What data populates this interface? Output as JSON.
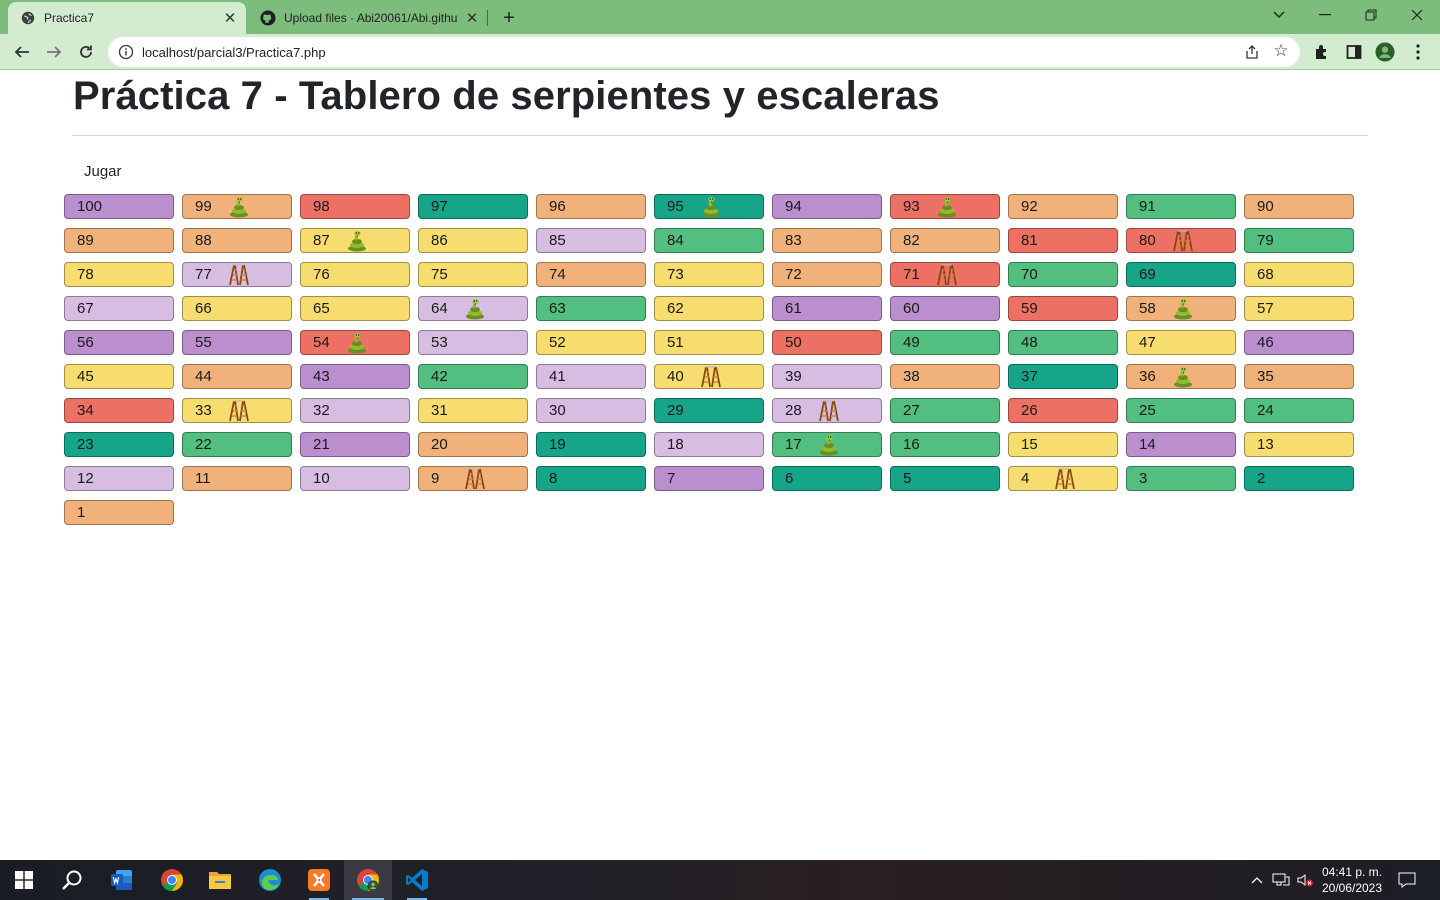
{
  "browser": {
    "tabs": [
      {
        "title": "Practica7",
        "active": true
      },
      {
        "title": "Upload files · Abi20061/Abi.githu",
        "active": false
      }
    ],
    "url": "localhost/parcial3/Practica7.php"
  },
  "page": {
    "title": "Práctica 7 - Tablero de serpientes y escaleras",
    "play_label": "Jugar"
  },
  "palette": {
    "purple": "#bb8fce",
    "orange": "#f0b27a",
    "red": "#ec7063",
    "teal": "#17a589",
    "green": "#52be80",
    "yellow": "#f7dc6f",
    "lavender": "#d7bde2"
  },
  "board": {
    "columns": 11,
    "cells": [
      {
        "n": "100",
        "c": "purple"
      },
      {
        "n": "99",
        "c": "orange",
        "icon": "snake"
      },
      {
        "n": "98",
        "c": "red"
      },
      {
        "n": "97",
        "c": "teal"
      },
      {
        "n": "96",
        "c": "orange"
      },
      {
        "n": "95",
        "c": "teal",
        "icon": "snake"
      },
      {
        "n": "94",
        "c": "purple"
      },
      {
        "n": "93",
        "c": "red",
        "icon": "snake"
      },
      {
        "n": "92",
        "c": "orange"
      },
      {
        "n": "91",
        "c": "green"
      },
      {
        "n": "90",
        "c": "orange"
      },
      {
        "n": "89",
        "c": "orange"
      },
      {
        "n": "88",
        "c": "orange"
      },
      {
        "n": "87",
        "c": "yellow",
        "icon": "snake"
      },
      {
        "n": "86",
        "c": "yellow"
      },
      {
        "n": "85",
        "c": "lavender"
      },
      {
        "n": "84",
        "c": "green"
      },
      {
        "n": "83",
        "c": "orange"
      },
      {
        "n": "82",
        "c": "orange"
      },
      {
        "n": "81",
        "c": "red"
      },
      {
        "n": "80",
        "c": "red",
        "icon": "ladder"
      },
      {
        "n": "79",
        "c": "green"
      },
      {
        "n": "78",
        "c": "yellow"
      },
      {
        "n": "77",
        "c": "lavender",
        "icon": "ladder"
      },
      {
        "n": "76",
        "c": "yellow"
      },
      {
        "n": "75",
        "c": "yellow"
      },
      {
        "n": "74",
        "c": "orange"
      },
      {
        "n": "73",
        "c": "yellow"
      },
      {
        "n": "72",
        "c": "orange"
      },
      {
        "n": "71",
        "c": "red",
        "icon": "ladder"
      },
      {
        "n": "70",
        "c": "green"
      },
      {
        "n": "69",
        "c": "teal"
      },
      {
        "n": "68",
        "c": "yellow"
      },
      {
        "n": "67",
        "c": "lavender"
      },
      {
        "n": "66",
        "c": "yellow"
      },
      {
        "n": "65",
        "c": "yellow"
      },
      {
        "n": "64",
        "c": "lavender",
        "icon": "snake"
      },
      {
        "n": "63",
        "c": "green"
      },
      {
        "n": "62",
        "c": "yellow"
      },
      {
        "n": "61",
        "c": "purple"
      },
      {
        "n": "60",
        "c": "purple"
      },
      {
        "n": "59",
        "c": "red"
      },
      {
        "n": "58",
        "c": "orange",
        "icon": "snake"
      },
      {
        "n": "57",
        "c": "yellow"
      },
      {
        "n": "56",
        "c": "purple"
      },
      {
        "n": "55",
        "c": "purple"
      },
      {
        "n": "54",
        "c": "red",
        "icon": "snake"
      },
      {
        "n": "53",
        "c": "lavender"
      },
      {
        "n": "52",
        "c": "yellow"
      },
      {
        "n": "51",
        "c": "yellow"
      },
      {
        "n": "50",
        "c": "red"
      },
      {
        "n": "49",
        "c": "green"
      },
      {
        "n": "48",
        "c": "green"
      },
      {
        "n": "47",
        "c": "yellow"
      },
      {
        "n": "46",
        "c": "purple"
      },
      {
        "n": "45",
        "c": "yellow"
      },
      {
        "n": "44",
        "c": "orange"
      },
      {
        "n": "43",
        "c": "purple"
      },
      {
        "n": "42",
        "c": "green"
      },
      {
        "n": "41",
        "c": "lavender"
      },
      {
        "n": "40",
        "c": "yellow",
        "icon": "ladder"
      },
      {
        "n": "39",
        "c": "lavender"
      },
      {
        "n": "38",
        "c": "orange"
      },
      {
        "n": "37",
        "c": "teal"
      },
      {
        "n": "36",
        "c": "orange",
        "icon": "snake"
      },
      {
        "n": "35",
        "c": "orange"
      },
      {
        "n": "34",
        "c": "red"
      },
      {
        "n": "33",
        "c": "yellow",
        "icon": "ladder"
      },
      {
        "n": "32",
        "c": "lavender"
      },
      {
        "n": "31",
        "c": "yellow"
      },
      {
        "n": "30",
        "c": "lavender"
      },
      {
        "n": "29",
        "c": "teal"
      },
      {
        "n": "28",
        "c": "lavender",
        "icon": "ladder"
      },
      {
        "n": "27",
        "c": "green"
      },
      {
        "n": "26",
        "c": "red"
      },
      {
        "n": "25",
        "c": "green"
      },
      {
        "n": "24",
        "c": "green"
      },
      {
        "n": "23",
        "c": "teal"
      },
      {
        "n": "22",
        "c": "green"
      },
      {
        "n": "21",
        "c": "purple"
      },
      {
        "n": "20",
        "c": "orange"
      },
      {
        "n": "19",
        "c": "teal"
      },
      {
        "n": "18",
        "c": "lavender"
      },
      {
        "n": "17",
        "c": "green",
        "icon": "snake"
      },
      {
        "n": "16",
        "c": "green"
      },
      {
        "n": "15",
        "c": "yellow"
      },
      {
        "n": "14",
        "c": "purple"
      },
      {
        "n": "13",
        "c": "yellow"
      },
      {
        "n": "12",
        "c": "lavender"
      },
      {
        "n": "11",
        "c": "orange"
      },
      {
        "n": "10",
        "c": "lavender"
      },
      {
        "n": "9",
        "c": "orange",
        "icon": "ladder"
      },
      {
        "n": "8",
        "c": "teal"
      },
      {
        "n": "7",
        "c": "purple"
      },
      {
        "n": "6",
        "c": "teal"
      },
      {
        "n": "5",
        "c": "teal"
      },
      {
        "n": "4",
        "c": "yellow",
        "icon": "ladder"
      },
      {
        "n": "3",
        "c": "green"
      },
      {
        "n": "2",
        "c": "teal"
      },
      {
        "n": "1",
        "c": "orange"
      }
    ]
  },
  "taskbar": {
    "time": "04:41 p. m.",
    "date": "20/06/2023"
  }
}
